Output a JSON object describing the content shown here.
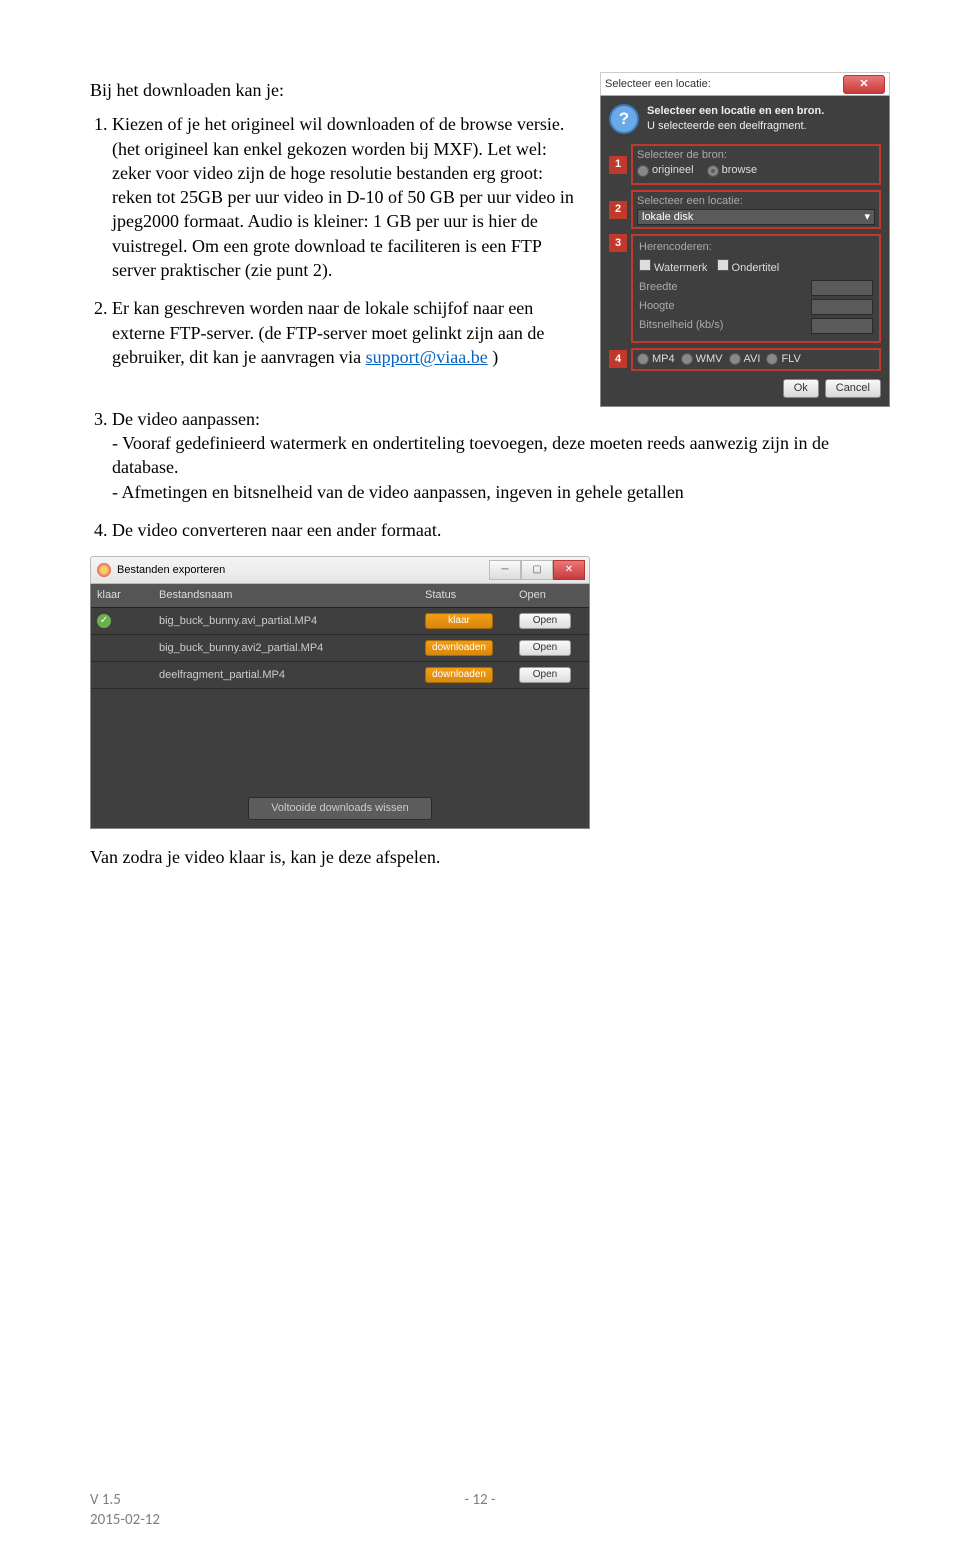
{
  "intro": "Bij het downloaden kan je:",
  "item1": "Kiezen of je het origineel wil downloaden of de browse versie. (het origineel kan enkel gekozen worden bij MXF). Let wel: zeker voor video zijn de hoge resolutie bestanden erg groot: reken tot 25GB per uur video in D-10 of 50 GB per uur video in jpeg2000 formaat. Audio is kleiner: 1 GB per uur is hier de vuistregel. Om een grote download te faciliteren is een FTP server praktischer (zie punt 2).",
  "item2_a": "Er kan geschreven worden naar de lokale schijfof naar een externe FTP-server. (de FTP-server moet gelinkt zijn aan de gebruiker, dit kan je aanvragen via ",
  "item2_link": "support@viaa.be",
  "item2_b": " )",
  "item3_intro": "De video aanpassen:",
  "item3_l1": "- Vooraf gedefinieerd watermerk en ondertiteling toevoegen, deze moeten reeds aanwezig zijn in de database.",
  "item3_l2": "- Afmetingen en bitsnelheid van de video aanpassen, ingeven in gehele getallen",
  "item4": "De video converteren naar een ander formaat.",
  "closing": "Van zodra je video klaar is, kan je deze afspelen.",
  "footer": {
    "version": "V 1.5",
    "date": "2015-02-12",
    "page": "- 12 -"
  },
  "dlg1": {
    "title": "Selecteer een locatie:",
    "msg_bold": "Selecteer een locatie en een bron.",
    "msg_line": "U selecteerde een deelfragment.",
    "sec1_label": "Selecteer de bron:",
    "sec1_opt1": "origineel",
    "sec1_opt2": "browse",
    "sec2_label": "Selecteer een locatie:",
    "sec2_val": "lokale disk",
    "sec3_label": "Herencoderen:",
    "sec3_chk1": "Watermerk",
    "sec3_chk2": "Ondertitel",
    "sec3_breedte": "Breedte",
    "sec3_hoogte": "Hoogte",
    "sec3_bit": "Bitsnelheid (kb/s)",
    "sec4": {
      "a": "MP4",
      "b": "WMV",
      "c": "AVI",
      "d": "FLV"
    },
    "btn_ok": "Ok",
    "btn_cancel": "Cancel",
    "tags": {
      "1": "1",
      "2": "2",
      "3": "3",
      "4": "4"
    }
  },
  "win2": {
    "title": "Bestanden exporteren",
    "hdr": {
      "klaar": "klaar",
      "name": "Bestandsnaam",
      "status": "Status",
      "open": "Open"
    },
    "rows": [
      {
        "done": true,
        "name": "big_buck_bunny.avi_partial.MP4",
        "status": "klaar",
        "open": "Open"
      },
      {
        "done": false,
        "name": "big_buck_bunny.avi2_partial.MP4",
        "status": "downloaden",
        "open": "Open"
      },
      {
        "done": false,
        "name": "deelfragment_partial.MP4",
        "status": "downloaden",
        "open": "Open"
      }
    ],
    "footer_btn": "Voltooide downloads wissen"
  }
}
